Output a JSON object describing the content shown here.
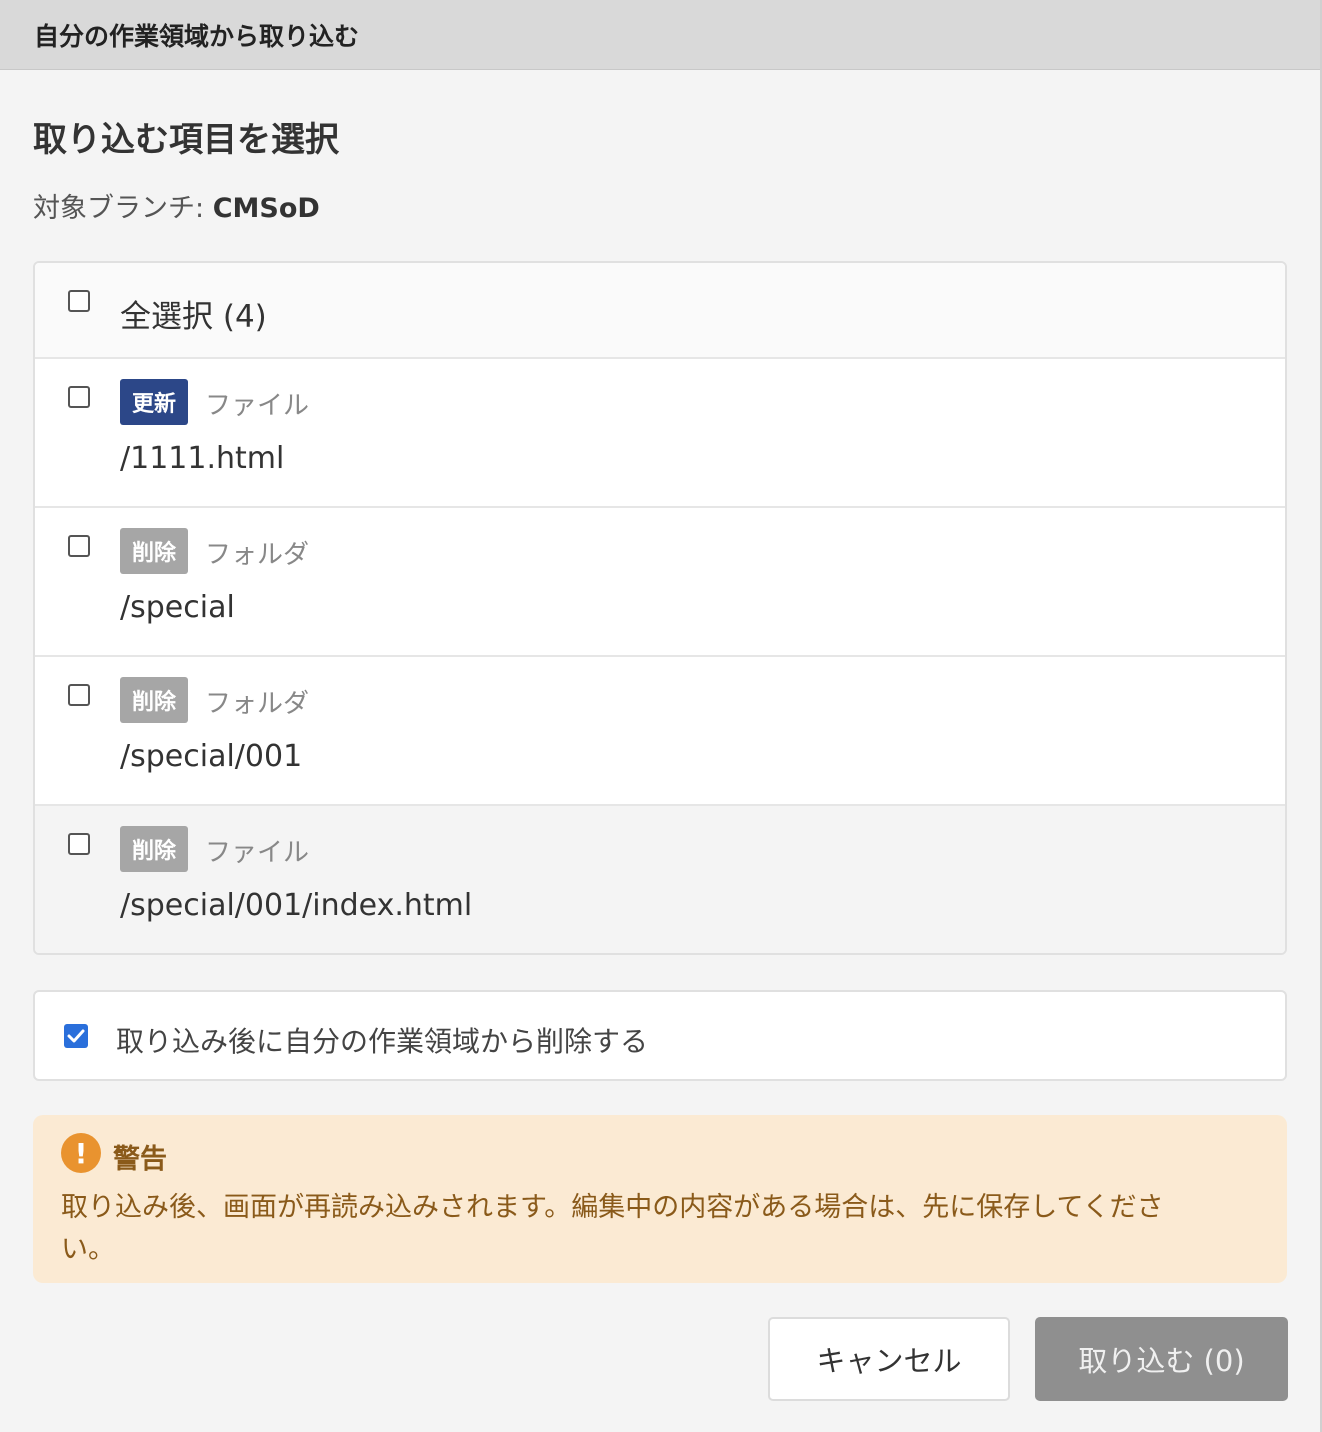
{
  "dialog": {
    "title": "自分の作業領域から取り込む",
    "heading": "取り込む項目を選択",
    "branch_label": "対象ブランチ: ",
    "branch_name": "CMSoD"
  },
  "select_all": {
    "label": "全選択 (4)",
    "checked": false
  },
  "items": [
    {
      "badge": "更新",
      "badge_color": "#2c4788",
      "kind": "ファイル",
      "path": "/1111.html",
      "checked": false
    },
    {
      "badge": "削除",
      "badge_color": "#a6a6a6",
      "kind": "フォルダ",
      "path": "/special",
      "checked": false
    },
    {
      "badge": "削除",
      "badge_color": "#a6a6a6",
      "kind": "フォルダ",
      "path": "/special/001",
      "checked": false
    },
    {
      "badge": "削除",
      "badge_color": "#a6a6a6",
      "kind": "ファイル",
      "path": "/special/001/index.html",
      "checked": false
    }
  ],
  "option": {
    "label": "取り込み後に自分の作業領域から削除する",
    "checked": true
  },
  "warning": {
    "icon": "exclamation-icon",
    "title": "警告",
    "message": "取り込み後、画面が再読み込みされます。編集中の内容がある場合は、先に保存してください。"
  },
  "buttons": {
    "cancel": "キャンセル",
    "import": "取り込む (0)"
  }
}
